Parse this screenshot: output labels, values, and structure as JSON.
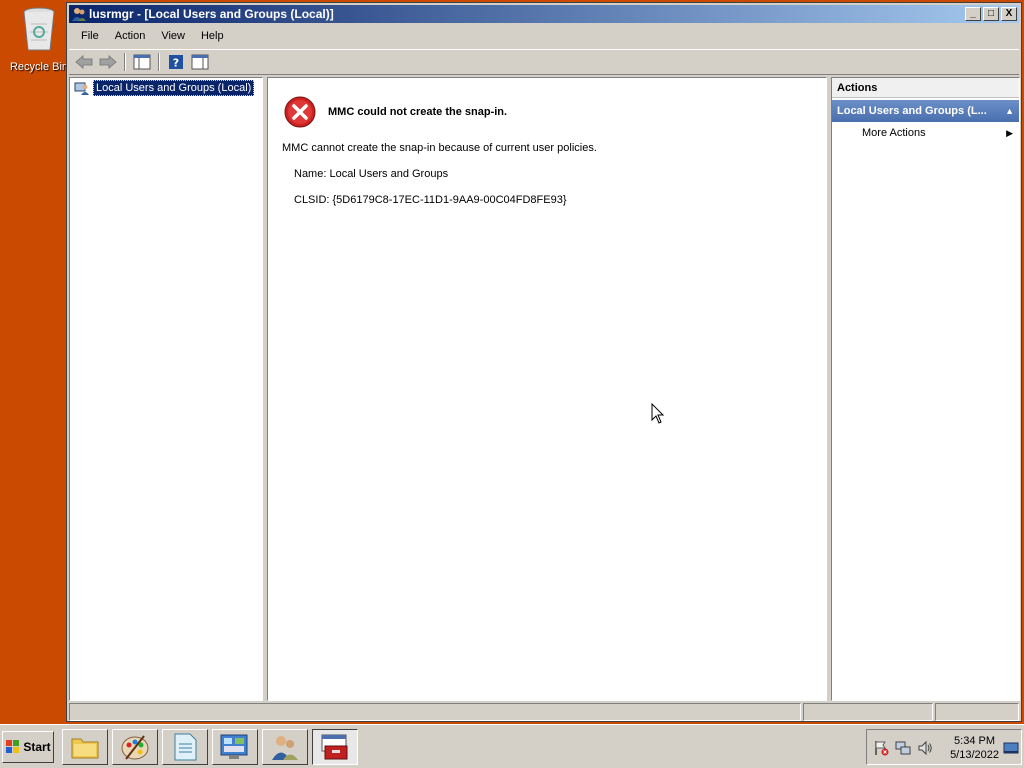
{
  "desktop": {
    "recycle_bin_label": "Recycle Bin"
  },
  "window": {
    "title": "lusrmgr - [Local Users and Groups (Local)]",
    "min_glyph": "_",
    "max_glyph": "□",
    "close_glyph": "X"
  },
  "menu": [
    "File",
    "Action",
    "View",
    "Help"
  ],
  "tree": {
    "root_label": "Local Users and Groups (Local)"
  },
  "error": {
    "title": "MMC could not create the snap-in.",
    "message": "MMC cannot create the snap-in because of current user policies.",
    "name_line": "Name: Local Users and Groups",
    "clsid_line": "CLSID: {5D6179C8-17EC-11D1-9AA9-00C04FD8FE93}"
  },
  "actions": {
    "header": "Actions",
    "group_label": "Local Users and Groups (L...",
    "more_actions": "More Actions"
  },
  "taskbar": {
    "start_label": "Start",
    "time": "5:34 PM",
    "date": "5/13/2022"
  },
  "colors": {
    "desktop": "#c94a00",
    "title_active": "#0a246a",
    "selection": "#0a246a",
    "error_red": "#cc2222"
  }
}
